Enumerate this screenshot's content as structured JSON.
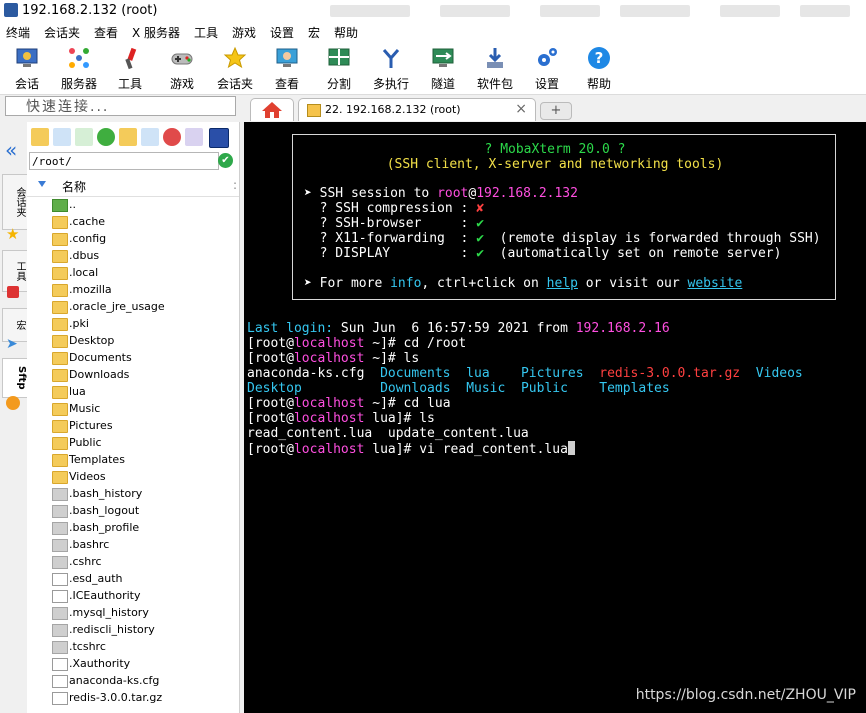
{
  "window": {
    "title": "192.168.2.132 (root)"
  },
  "menu": [
    "终端",
    "会话夹",
    "查看",
    "X 服务器",
    "工具",
    "游戏",
    "设置",
    "宏",
    "帮助"
  ],
  "toolbar": [
    {
      "label": "会话",
      "icon": "session-icon"
    },
    {
      "label": "服务器",
      "icon": "servers-icon"
    },
    {
      "label": "工具",
      "icon": "tools-icon"
    },
    {
      "label": "游戏",
      "icon": "games-icon"
    },
    {
      "label": "会话夹",
      "icon": "sessions-star-icon"
    },
    {
      "label": "查看",
      "icon": "view-icon"
    },
    {
      "label": "分割",
      "icon": "split-icon"
    },
    {
      "label": "多执行",
      "icon": "multiexec-icon"
    },
    {
      "label": "隧道",
      "icon": "tunnel-icon"
    },
    {
      "label": "软件包",
      "icon": "packages-icon"
    },
    {
      "label": "设置",
      "icon": "settings-icon"
    },
    {
      "label": "帮助",
      "icon": "help-icon"
    }
  ],
  "quick_connect": {
    "placeholder": "快速连接..."
  },
  "tabs": {
    "session_tab": "22. 192.168.2.132 (root)",
    "new_tab": "+"
  },
  "left_strip": {
    "collapse": "«",
    "sessions_tab": "会话夹",
    "tools_tab": "工具",
    "macros_tab": "宏",
    "sftp_tab": "Sftp"
  },
  "sftp": {
    "path": "/root/",
    "column_name": "名称",
    "files": [
      {
        "name": "..",
        "type": "up"
      },
      {
        "name": ".cache",
        "type": "folder"
      },
      {
        "name": ".config",
        "type": "folder"
      },
      {
        "name": ".dbus",
        "type": "folder"
      },
      {
        "name": ".local",
        "type": "folder"
      },
      {
        "name": ".mozilla",
        "type": "folder"
      },
      {
        "name": ".oracle_jre_usage",
        "type": "folder"
      },
      {
        "name": ".pki",
        "type": "folder"
      },
      {
        "name": "Desktop",
        "type": "folder"
      },
      {
        "name": "Documents",
        "type": "folder"
      },
      {
        "name": "Downloads",
        "type": "folder"
      },
      {
        "name": "lua",
        "type": "folder"
      },
      {
        "name": "Music",
        "type": "folder"
      },
      {
        "name": "Pictures",
        "type": "folder"
      },
      {
        "name": "Public",
        "type": "folder"
      },
      {
        "name": "Templates",
        "type": "folder"
      },
      {
        "name": "Videos",
        "type": "folder"
      },
      {
        "name": ".bash_history",
        "type": "file"
      },
      {
        "name": ".bash_logout",
        "type": "file"
      },
      {
        "name": ".bash_profile",
        "type": "file"
      },
      {
        "name": ".bashrc",
        "type": "file"
      },
      {
        "name": ".cshrc",
        "type": "file"
      },
      {
        "name": ".esd_auth",
        "type": "doc"
      },
      {
        "name": ".ICEauthority",
        "type": "doc"
      },
      {
        "name": ".mysql_history",
        "type": "file"
      },
      {
        "name": ".rediscli_history",
        "type": "file"
      },
      {
        "name": ".tcshrc",
        "type": "file"
      },
      {
        "name": ".Xauthority",
        "type": "doc"
      },
      {
        "name": "anaconda-ks.cfg",
        "type": "doc"
      },
      {
        "name": "redis-3.0.0.tar.gz",
        "type": "doc"
      }
    ]
  },
  "terminal": {
    "banner_title": "? MobaXterm 20.0 ?",
    "banner_subtitle": "(SSH client, X-server and networking tools)",
    "ssh_session_prefix": "➤ SSH session to ",
    "ssh_user": "root",
    "ssh_at": "@",
    "ssh_host": "192.168.2.132",
    "features": [
      {
        "label": "  ? SSH compression : ",
        "mark": "✘",
        "note": ""
      },
      {
        "label": "  ? SSH-browser     : ",
        "mark": "✔",
        "note": ""
      },
      {
        "label": "  ? X11-forwarding  : ",
        "mark": "✔",
        "note": "  (remote display is forwarded through SSH)"
      },
      {
        "label": "  ? DISPLAY         : ",
        "mark": "✔",
        "note": "  (automatically set on remote server)"
      }
    ],
    "info_prefix": "➤ For more ",
    "info_word": "info",
    "info_mid": ", ctrl+click on ",
    "help_word": "help",
    "info_or": " or visit our ",
    "website_word": "website",
    "last_login_label": "Last login:",
    "last_login_text": " Sun Jun  6 16:57:59 2021 from ",
    "last_login_ip": "192.168.2.16",
    "prompt_open": "[root@",
    "prompt_host": "localhost",
    "cmd1": " ~]# cd /root",
    "cmd2": " ~]# ls",
    "ls1_plain1": "anaconda-ks.cfg  ",
    "ls1_dir1": "Documents",
    "ls1_gap1": "  ",
    "ls1_dir2": "lua",
    "ls1_gap2": "    ",
    "ls1_dir3": "Pictures",
    "ls1_gap3": "  ",
    "ls1_archive": "redis-3.0.0.tar.gz",
    "ls1_gap4": "  ",
    "ls1_dir4": "Videos",
    "ls2_dir1": "Desktop",
    "ls2_gap1": "          ",
    "ls2_dir2": "Downloads",
    "ls2_gap2": "  ",
    "ls2_dir3": "Music",
    "ls2_gap3": "  ",
    "ls2_dir4": "Public",
    "ls2_gap4": "    ",
    "ls2_dir5": "Templates",
    "cmd3": " ~]# cd lua",
    "cmd4": " lua]# ls",
    "ls3": "read_content.lua  update_content.lua",
    "cmd5": " lua]# vi read_content.lua"
  },
  "watermark": "https://blog.csdn.net/ZHOU_VIP",
  "colors": {
    "terminal_bg": "#000000",
    "prompt_host": "#ff4fe0",
    "dir": "#35c7f0",
    "banner_green": "#2cd94a",
    "banner_yellow": "#f2e048"
  }
}
